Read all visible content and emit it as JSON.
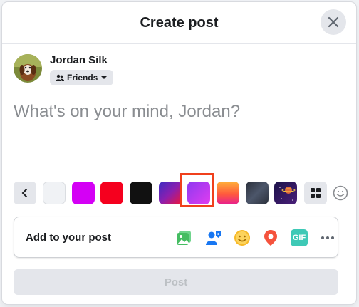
{
  "dialog": {
    "title": "Create post"
  },
  "user": {
    "name": "Jordan Silk",
    "audience": "Friends"
  },
  "composer": {
    "placeholder": "What's on your mind, Jordan?"
  },
  "backgrounds": {
    "swatches": [
      {
        "name": "white",
        "color": "#f0f2f5"
      },
      {
        "name": "magenta",
        "color": "#d400f5"
      },
      {
        "name": "red",
        "color": "#f5001e"
      },
      {
        "name": "black",
        "color": "#111111"
      },
      {
        "name": "purple-red-gradient",
        "color": "#7a1fa2"
      },
      {
        "name": "violet-gradient",
        "color": "#c13ef0"
      },
      {
        "name": "orange-pink-gradient",
        "color": "#ff6b3d"
      },
      {
        "name": "dark-slate-pattern",
        "color": "#3b4252"
      },
      {
        "name": "space-illustration",
        "color": "#2a1a5e"
      }
    ],
    "selected_index": 5
  },
  "add_to_post": {
    "label": "Add to your post",
    "items": [
      "photo-video-icon",
      "tag-people-icon",
      "feeling-icon",
      "check-in-icon",
      "gif-icon",
      "more-icon"
    ],
    "gif_text": "GIF"
  },
  "post_button": {
    "label": "Post"
  }
}
